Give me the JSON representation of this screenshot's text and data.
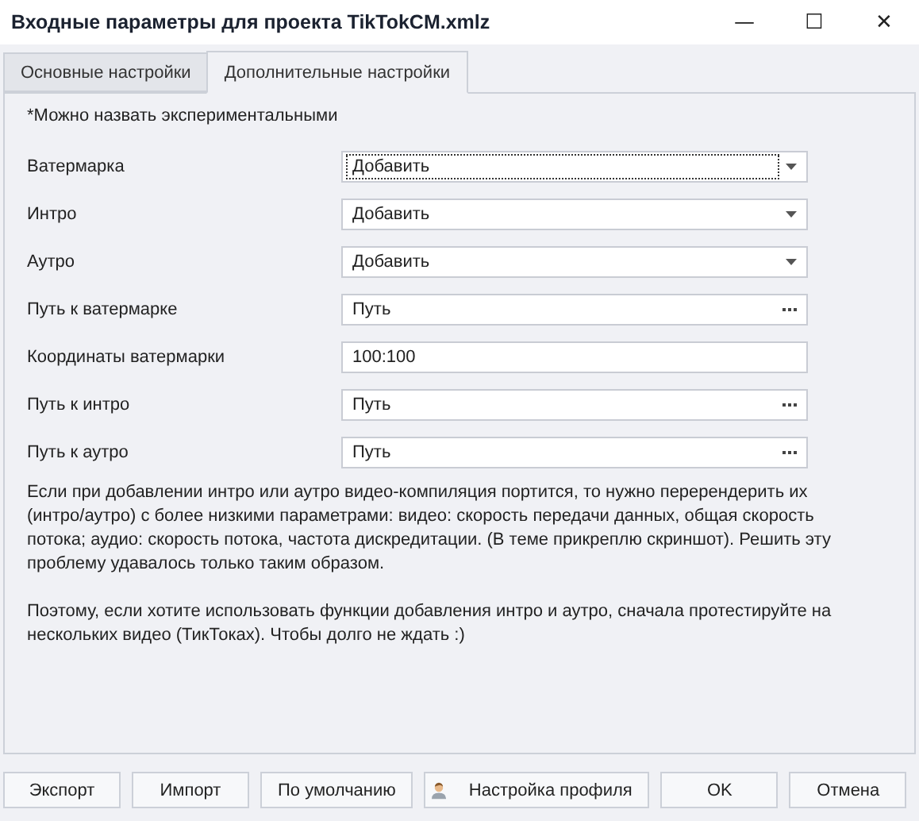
{
  "window": {
    "title": "Входные параметры для проекта TikTokCM.xmlz",
    "controls": [
      "—",
      "☐",
      "✕"
    ]
  },
  "tabs": [
    {
      "label": "Основные настройки",
      "selected": false
    },
    {
      "label": "Дополнительные настройки",
      "selected": true
    }
  ],
  "note": "*Можно назвать экспериментальными",
  "fields": [
    {
      "label": "Ватермарка",
      "kind": "dropdown",
      "value": "Добавить",
      "focused": true
    },
    {
      "label": "Интро",
      "kind": "dropdown",
      "value": "Добавить",
      "focused": false
    },
    {
      "label": "Аутро",
      "kind": "dropdown",
      "value": "Добавить",
      "focused": false
    },
    {
      "label": "Путь к ватермарке",
      "kind": "browse",
      "value": "Путь",
      "focused": false
    },
    {
      "label": "Координаты ватермарки",
      "kind": "text",
      "value": "100:100",
      "focused": false
    },
    {
      "label": "Путь к интро",
      "kind": "browse",
      "value": "Путь",
      "focused": false
    },
    {
      "label": "Путь к аутро",
      "kind": "browse",
      "value": "Путь",
      "focused": false
    }
  ],
  "paragraphs": [
    "Если при добавлении интро или аутро видео-компиляция портится, то нужно перерендерить их (интро/аутро) с более низкими параметрами: видео: скорость передачи данных, общая скорость потока; аудио: скорость потока, частота дискредитации. (В теме прикреплю скриншот). Решить эту проблему удавалось только таким образом.",
    "Поэтому, если хотите использовать функции добавления интро и аутро, сначала протестируйте на нескольких видео (ТикТоках). Чтобы долго не ждать :)"
  ],
  "buttons": [
    {
      "label": "Экспорт",
      "kind": "plain"
    },
    {
      "label": "Импорт",
      "kind": "plain"
    },
    {
      "label": "По умолчанию",
      "kind": "plain"
    },
    {
      "label": "Настройка профиля",
      "kind": "profile"
    },
    {
      "label": "OK",
      "kind": "plain"
    },
    {
      "label": "Отмена",
      "kind": "plain"
    }
  ]
}
